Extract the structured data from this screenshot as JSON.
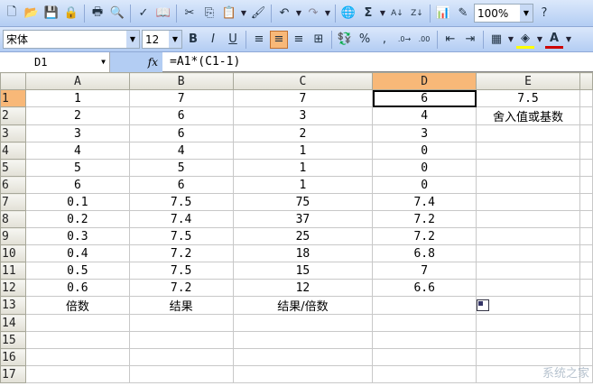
{
  "toolbar": {
    "zoom": "100%",
    "font": "宋体",
    "size": "12"
  },
  "formula_bar": {
    "name_box": "D1",
    "fx": "fx",
    "formula": "=A1*(C1-1)"
  },
  "columns": [
    "A",
    "B",
    "C",
    "D",
    "E"
  ],
  "rows": [
    [
      "1",
      "7",
      "7",
      "6",
      "7.5"
    ],
    [
      "2",
      "6",
      "3",
      "4",
      "舍入值或基数"
    ],
    [
      "3",
      "6",
      "2",
      "3",
      ""
    ],
    [
      "4",
      "4",
      "1",
      "0",
      ""
    ],
    [
      "5",
      "5",
      "1",
      "0",
      ""
    ],
    [
      "6",
      "6",
      "1",
      "0",
      ""
    ],
    [
      "0.1",
      "7.5",
      "75",
      "7.4",
      ""
    ],
    [
      "0.2",
      "7.4",
      "37",
      "7.2",
      ""
    ],
    [
      "0.3",
      "7.5",
      "25",
      "7.2",
      ""
    ],
    [
      "0.4",
      "7.2",
      "18",
      "6.8",
      ""
    ],
    [
      "0.5",
      "7.5",
      "15",
      "7",
      ""
    ],
    [
      "0.6",
      "7.2",
      "12",
      "6.6",
      ""
    ],
    [
      "倍数",
      "结果",
      "结果/倍数",
      "",
      ""
    ],
    [
      "",
      "",
      "",
      "",
      ""
    ],
    [
      "",
      "",
      "",
      "",
      ""
    ],
    [
      "",
      "",
      "",
      "",
      ""
    ],
    [
      "",
      "",
      "",
      "",
      ""
    ]
  ],
  "watermark": "系统之家"
}
